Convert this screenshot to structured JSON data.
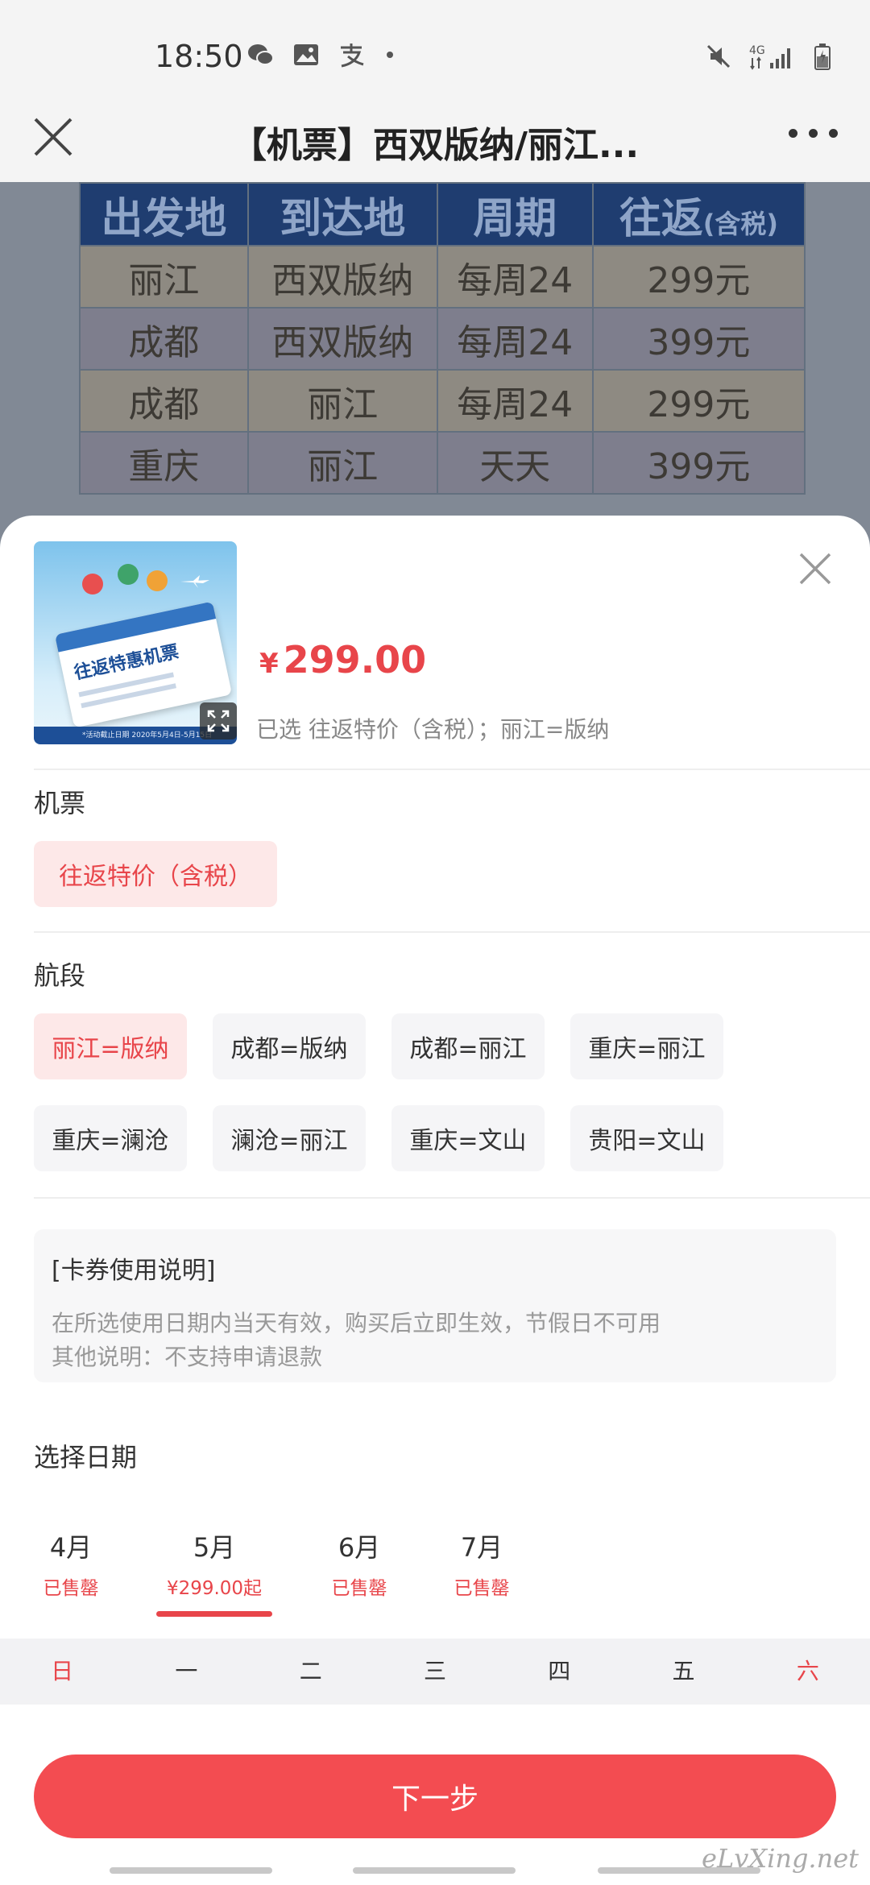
{
  "status_bar": {
    "time": "18:50",
    "network_label": "4G",
    "icons_left": [
      "wechat-icon",
      "gallery-icon",
      "alipay-icon"
    ],
    "icons_right": [
      "mute-icon",
      "signal-icon",
      "battery-icon"
    ]
  },
  "nav": {
    "title": "【机票】西双版纳/丽江...",
    "close_icon": "close-icon",
    "more_icon": "more-icon"
  },
  "background_table": {
    "headers": [
      "出发地",
      "到达地",
      "周期",
      "往返"
    ],
    "header_suffix": "(含税)",
    "rows": [
      [
        "丽江",
        "西双版纳",
        "每周24",
        "299元"
      ],
      [
        "成都",
        "西双版纳",
        "每周24",
        "399元"
      ],
      [
        "成都",
        "丽江",
        "每周24",
        "299元"
      ],
      [
        "重庆",
        "丽江",
        "天天",
        "399元"
      ]
    ]
  },
  "product": {
    "image_caption": "往返特惠机票",
    "image_footer": "*活动截止日期 2020年5月4日-5月15日",
    "currency": "¥",
    "price": "299.00",
    "selected": "已选 往返特价（含税）；丽江=版纳"
  },
  "ticket_section": {
    "title": "机票",
    "options": [
      {
        "label": "往返特价（含税）",
        "active": true
      }
    ]
  },
  "route_section": {
    "title": "航段",
    "options": [
      {
        "label": "丽江=版纳",
        "active": true
      },
      {
        "label": "成都=版纳",
        "active": false
      },
      {
        "label": "成都=丽江",
        "active": false
      },
      {
        "label": "重庆=丽江",
        "active": false
      },
      {
        "label": "重庆=澜沧",
        "active": false
      },
      {
        "label": "澜沧=丽江",
        "active": false
      },
      {
        "label": "重庆=文山",
        "active": false
      },
      {
        "label": "贵阳=文山",
        "active": false
      }
    ]
  },
  "notice": {
    "title": "[卡券使用说明]",
    "lines": [
      "在所选使用日期内当天有效，购买后立即生效，节假日不可用",
      "其他说明：不支持申请退款"
    ]
  },
  "date_section": {
    "title": "选择日期",
    "months": [
      {
        "name": "4月",
        "status": "已售罄"
      },
      {
        "name": "5月",
        "status": "¥299.00起",
        "selected": true
      },
      {
        "name": "6月",
        "status": "已售罄"
      },
      {
        "name": "7月",
        "status": "已售罄"
      }
    ],
    "weekdays": [
      "日",
      "一",
      "二",
      "三",
      "四",
      "五",
      "六"
    ]
  },
  "next_button": "下一步",
  "watermark": "eLvXing.net",
  "colors": {
    "accent": "#e8454a",
    "button": "#f34c51",
    "chip_active_bg": "#fde8e8",
    "chip_bg": "#f5f5f7"
  }
}
